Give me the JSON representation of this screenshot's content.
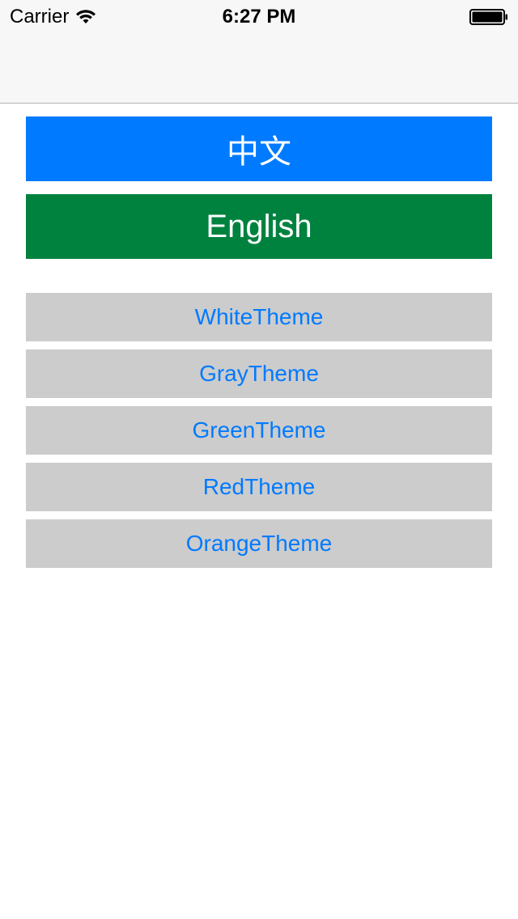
{
  "status_bar": {
    "carrier": "Carrier",
    "time": "6:27 PM",
    "wifi_icon": "wifi-icon",
    "battery_icon": "battery-full-icon"
  },
  "colors": {
    "chinese_button_bg": "#007aff",
    "english_button_bg": "#00823f",
    "theme_button_bg": "#cccccc",
    "theme_button_text": "#007aff"
  },
  "language_buttons": {
    "chinese_label": "中文",
    "english_label": "English"
  },
  "theme_buttons": [
    {
      "label": "WhiteTheme"
    },
    {
      "label": "GrayTheme"
    },
    {
      "label": "GreenTheme"
    },
    {
      "label": "RedTheme"
    },
    {
      "label": "OrangeTheme"
    }
  ]
}
